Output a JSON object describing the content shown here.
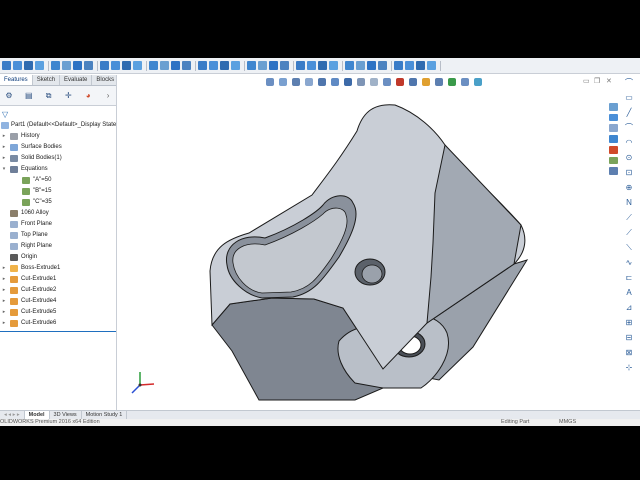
{
  "tabs": [
    "Features",
    "Sketch",
    "Evaluate",
    "Blocks"
  ],
  "tree": {
    "root": "Part1  (Default<<Default>_Display State",
    "items": [
      {
        "label": "History",
        "icon": "history-icon"
      },
      {
        "label": "Surface Bodies",
        "icon": "surface-bodies-icon"
      },
      {
        "label": "Solid Bodies(1)",
        "icon": "solid-bodies-icon"
      },
      {
        "label": "Equations",
        "icon": "equations-icon"
      },
      {
        "label": "\"A\"=50",
        "icon": "global-variable-icon"
      },
      {
        "label": "\"B\"=15",
        "icon": "global-variable-icon"
      },
      {
        "label": "\"C\"=35",
        "icon": "global-variable-icon"
      },
      {
        "label": "1060 Alloy",
        "icon": "material-icon"
      },
      {
        "label": "Front Plane",
        "icon": "plane-icon"
      },
      {
        "label": "Top Plane",
        "icon": "plane-icon"
      },
      {
        "label": "Right Plane",
        "icon": "plane-icon"
      },
      {
        "label": "Origin",
        "icon": "origin-icon"
      },
      {
        "label": "Boss-Extrude1",
        "icon": "boss-extrude-icon"
      },
      {
        "label": "Cut-Extrude1",
        "icon": "cut-extrude-icon"
      },
      {
        "label": "Cut-Extrude2",
        "icon": "cut-extrude-icon"
      },
      {
        "label": "Cut-Extrude4",
        "icon": "cut-extrude-icon"
      },
      {
        "label": "Cut-Extrude5",
        "icon": "cut-extrude-icon"
      },
      {
        "label": "Cut-Extrude6",
        "icon": "cut-extrude-icon"
      }
    ]
  },
  "bottom_tabs": [
    "Model",
    "3D Views",
    "Motion Study 1"
  ],
  "status": {
    "left": "OLIDWORKS Premium 2016 x64 Edition",
    "mid": "Editing Part",
    "units": "MMGS"
  },
  "colors": {
    "accent": "#1f6fbf",
    "part_face": "#c9ced6",
    "part_shadow": "#8f96a1",
    "part_edge": "#1b1b1b"
  }
}
